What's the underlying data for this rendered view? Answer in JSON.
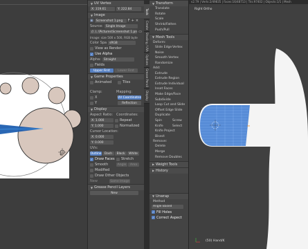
{
  "uv_panel": {
    "uv_vertex": {
      "title": "UV Vertex",
      "x_label": "X:",
      "x_value": "319.61",
      "y_label": "Y:",
      "y_value": "222.84"
    },
    "image": {
      "title": "Image",
      "image_name": "Screenshot 1.png",
      "source_label": "Source:",
      "source_value": "Single Image",
      "filepath": "//..\\..\\Pictures\\Screenshot 1.png",
      "info": "Image: size 500 x 500, RGB byte",
      "color_space_label": "Color Spa",
      "color_space_value": "sRGB",
      "view_as_render": "View as Render",
      "use_alpha": "Use Alpha",
      "alpha_label": "Alpha:",
      "alpha_value": "Straight",
      "fields": "Fields",
      "upper_first": "Upper First",
      "lower_first": "Lower First"
    },
    "game_properties": {
      "title": "Game Properties",
      "animated": "Animated",
      "tiles": "Tiles",
      "clamp": "Clamp:",
      "mapping": "Mapping:",
      "x": "X",
      "y": "Y",
      "uv_coordinates": "UV Coordinates",
      "reflection": "Reflection"
    },
    "display": {
      "title": "Display",
      "aspect_ratio": "Aspect Ratio:",
      "coordinates": "Coordinates:",
      "ax": "X:",
      "ax_value": "1.000",
      "ay": "Y:",
      "ay_value": "1.000",
      "repeat": "Repeat",
      "normalized": "Normalized",
      "cursor_location": "Cursor Location:",
      "cx": "X:",
      "cx_value": "0.000",
      "cy": "Y:",
      "cy_value": "0.000",
      "uvs": "UVs:",
      "uv_modes": [
        "Outline",
        "Dash",
        "Black",
        "White"
      ],
      "draw_faces": "Draw Faces",
      "stretch": "Stretch",
      "smooth": "Smooth",
      "angle": "Angle",
      "area": "Area",
      "modified": "Modified",
      "draw_other_objects": "Draw Other Objects",
      "new": "New",
      "same_image": "Same Image"
    },
    "grease_pencil": {
      "title": "Grease Pencil Layers",
      "new_label": "New"
    }
  },
  "tabs": [
    "Tools",
    "Create",
    "Shading / UVs",
    "Options",
    "Grease Pencil",
    "Display"
  ],
  "shelf": {
    "transform": {
      "title": "Transform",
      "items": [
        "Translate",
        "Rotate",
        "Scale",
        "Shrink/Fatten",
        "Push/Pull"
      ]
    },
    "mesh_tools": {
      "title": "Mesh Tools",
      "deform": "Deform:",
      "slide_edge": "Slide Edge",
      "vertex": "Vertex",
      "noise": "Noise",
      "smooth_vertex": "Smooth Vertex",
      "randomize": "Randomize",
      "add": "Add:",
      "add_items": [
        "Extrude",
        "Extrude Region",
        "Extrude Individual",
        "Inset Faces",
        "Make Edge/Face",
        "Subdivide",
        "Loop Cut and Slide",
        "Offset Edge Slide",
        "Duplicate"
      ],
      "spin": "Spin",
      "screw": "Screw",
      "knife": "Knife",
      "select": "Select",
      "knife_project": "Knife Project",
      "bisect": "Bisect",
      "remove": "Remove:",
      "delete": "Delete",
      "merge": "Merge",
      "remove_doubles": "Remove Doubles"
    },
    "weight_tools": {
      "title": "Weight Tools"
    },
    "history": {
      "title": "History"
    },
    "unwrap": {
      "title": "Unwrap",
      "method": "Method",
      "method_value": "Angle Based",
      "fill_holes": "Fill Holes",
      "correct_aspect": "Correct Aspect"
    }
  },
  "viewport3d": {
    "top_info": "v2.79 | Verts:2/49835 | Faces:16/48713 | Tris:97402 | Objects:1/1 | Mesh",
    "view_name": "Right Ortho",
    "object_name": "(50) Hand/K"
  },
  "colors": {
    "accent": "#5680c2",
    "panel": "#434343",
    "viewport": "#404040",
    "selection": "#e08a2a",
    "uv_fill": "#d8c7bd"
  }
}
